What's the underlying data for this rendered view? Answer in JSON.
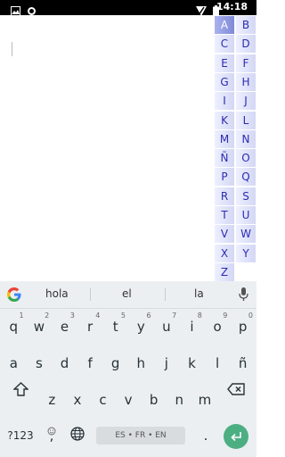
{
  "status_bar": {
    "time": "14:18",
    "icons": [
      "image-icon",
      "record-icon",
      "wifi-icon",
      "battery-icon"
    ]
  },
  "letters": [
    "A",
    "B",
    "C",
    "D",
    "E",
    "F",
    "G",
    "H",
    "I",
    "J",
    "K",
    "L",
    "M",
    "N",
    "Ñ",
    "O",
    "P",
    "Q",
    "R",
    "S",
    "T",
    "U",
    "V",
    "W",
    "X",
    "Y",
    "Z"
  ],
  "active_letter": "A",
  "keyboard": {
    "suggestions": [
      "hola",
      "el",
      "la"
    ],
    "row1": [
      {
        "label": "q",
        "hint": "1"
      },
      {
        "label": "w",
        "hint": "2"
      },
      {
        "label": "e",
        "hint": "3"
      },
      {
        "label": "r",
        "hint": "4"
      },
      {
        "label": "t",
        "hint": "5"
      },
      {
        "label": "y",
        "hint": "6"
      },
      {
        "label": "u",
        "hint": "7"
      },
      {
        "label": "i",
        "hint": "8"
      },
      {
        "label": "o",
        "hint": "9"
      },
      {
        "label": "p",
        "hint": "0"
      }
    ],
    "row2": [
      "a",
      "s",
      "d",
      "f",
      "g",
      "h",
      "j",
      "k",
      "l",
      "ñ"
    ],
    "row3": [
      "z",
      "x",
      "c",
      "v",
      "b",
      "n",
      "m"
    ],
    "symbols_label": "?123",
    "comma_label": ",",
    "period_label": ".",
    "space_label": "ES • FR • EN"
  },
  "colors": {
    "accent": "#4caf82",
    "letter_text": "#2b2bb0"
  }
}
